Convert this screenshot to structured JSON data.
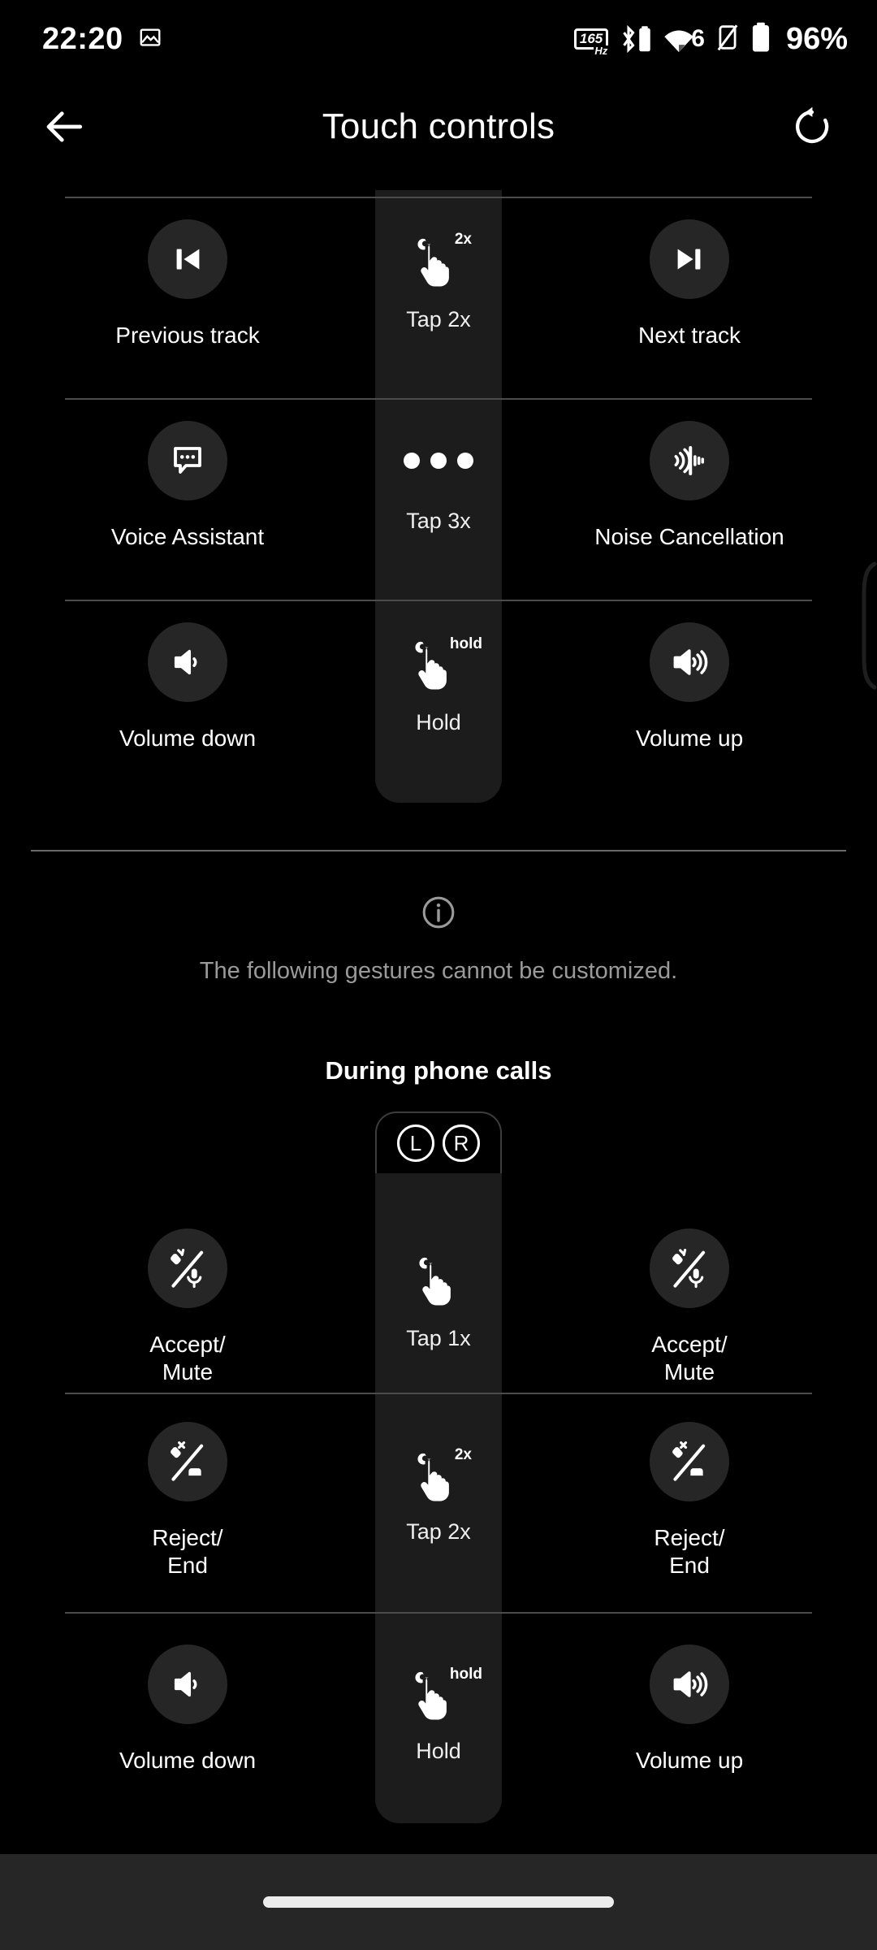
{
  "statusbar": {
    "time": "22:20",
    "battery_percent": "96%",
    "refresh_rate": "165",
    "refresh_unit": "Hz",
    "icons": [
      "gallery-icon",
      "refresh-rate-badge",
      "bluetooth-icon",
      "bluetooth-battery-icon",
      "wifi-icon",
      "wifi-generation-6",
      "vibrate-off-icon",
      "battery-icon"
    ],
    "wifi_generation": "6"
  },
  "header": {
    "title": "Touch controls",
    "back_label": "Back",
    "reset_label": "Reset"
  },
  "customizable_section": {
    "rows": [
      {
        "left": {
          "label": "Previous track",
          "icon": "previous-track-icon"
        },
        "gesture": {
          "label": "Tap 2x",
          "icon": "tap-hand-icon",
          "sup": "2x"
        },
        "right": {
          "label": "Next track",
          "icon": "next-track-icon"
        }
      },
      {
        "left": {
          "label": "Voice Assistant",
          "icon": "voice-assistant-icon"
        },
        "gesture": {
          "label": "Tap 3x",
          "icon": "three-dots-icon",
          "sup": ""
        },
        "right": {
          "label": "Noise Cancellation",
          "icon": "noise-cancellation-icon"
        }
      },
      {
        "left": {
          "label": "Volume down",
          "icon": "volume-down-icon"
        },
        "gesture": {
          "label": "Hold",
          "icon": "tap-hand-icon",
          "sup": "hold"
        },
        "right": {
          "label": "Volume up",
          "icon": "volume-up-icon"
        }
      }
    ]
  },
  "info": {
    "icon": "info-icon",
    "text": "The following gestures cannot be customized."
  },
  "calls_section": {
    "title": "During phone calls",
    "earbud_left": "L",
    "earbud_right": "R",
    "rows": [
      {
        "left": {
          "label": "Accept/\nMute",
          "icon": "accept-mute-icon"
        },
        "gesture": {
          "label": "Tap 1x",
          "icon": "tap-hand-icon",
          "sup": ""
        },
        "right": {
          "label": "Accept/\nMute",
          "icon": "accept-mute-icon"
        }
      },
      {
        "left": {
          "label": "Reject/\nEnd",
          "icon": "reject-end-icon"
        },
        "gesture": {
          "label": "Tap 2x",
          "icon": "tap-hand-icon",
          "sup": "2x"
        },
        "right": {
          "label": "Reject/\nEnd",
          "icon": "reject-end-icon"
        }
      },
      {
        "left": {
          "label": "Volume down",
          "icon": "volume-down-icon"
        },
        "gesture": {
          "label": "Hold",
          "icon": "tap-hand-icon",
          "sup": "hold"
        },
        "right": {
          "label": "Volume up",
          "icon": "volume-up-icon"
        }
      }
    ]
  },
  "navbar": {
    "gesture_pill": "home-gesture-pill"
  },
  "colors": {
    "background": "#000000",
    "strip": "#1c1c1c",
    "circle": "#262626",
    "divider": "#4b4b4b",
    "muted_text": "#9a9a9a",
    "navbar": "#262626"
  }
}
